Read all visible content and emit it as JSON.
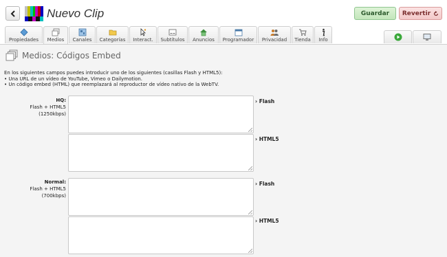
{
  "header": {
    "title": "Nuevo Clip",
    "save_label": "Guardar",
    "revert_label": "Revertir"
  },
  "tabs": [
    {
      "label": "Propiedades",
      "icon": "diamond-icon"
    },
    {
      "label": "Medios",
      "icon": "media-icon"
    },
    {
      "label": "Canales",
      "icon": "channels-icon"
    },
    {
      "label": "Categorías",
      "icon": "folder-icon"
    },
    {
      "label": "Interact.",
      "icon": "cursor-icon"
    },
    {
      "label": "Subtítulos",
      "icon": "subtitles-icon"
    },
    {
      "label": "Anuncios",
      "icon": "house-icon"
    },
    {
      "label": "Programador",
      "icon": "calendar-icon"
    },
    {
      "label": "Privacidad",
      "icon": "users-icon"
    },
    {
      "label": "Tienda",
      "icon": "cart-icon"
    },
    {
      "label": "Info",
      "icon": "info-icon"
    }
  ],
  "active_tab": "Medios",
  "section": {
    "title": "Medios: Códigos Embed",
    "intro_line1": "En los siguientes campos puedes introducir uno de los siguientes (casillas Flash y HTML5):",
    "intro_line2": "• Una URL de un vídeo de YouTube, Vimeo o Dailymotion.",
    "intro_line3": "• Un código embed (HTML) que reemplazará al reproductor de vídeo nativo de la WebTV."
  },
  "groups": [
    {
      "name": "HQ:",
      "format": "Flash + HTML5",
      "bitrate": "(1250kbps)",
      "flash_label": "› Flash",
      "html5_label": "› HTML5",
      "flash_value": "",
      "html5_value": ""
    },
    {
      "name": "Normal:",
      "format": "Flash + HTML5",
      "bitrate": "(700kbps)",
      "flash_label": "› Flash",
      "html5_label": "› HTML5",
      "flash_value": "",
      "html5_value": ""
    }
  ],
  "colors": {
    "save_bg": "#c9e9c1",
    "revert_bg": "#f6d2d2",
    "page_bg": "#f4f4f4"
  }
}
